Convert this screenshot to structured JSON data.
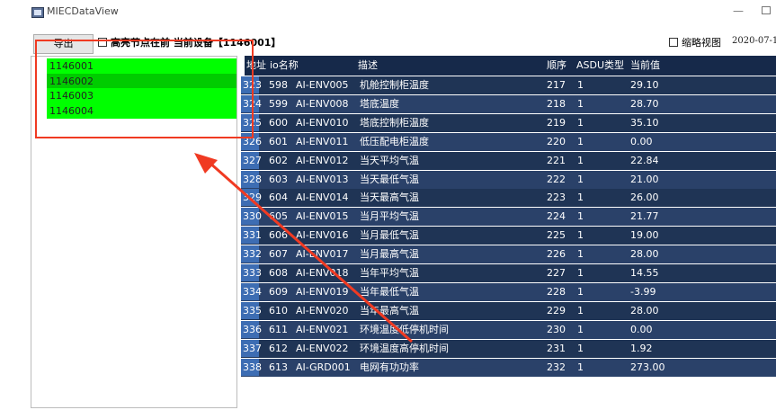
{
  "window": {
    "title": "MIECDataView",
    "minimize_glyph": "—"
  },
  "toolbar": {
    "export_label": "导出",
    "show_label": "高亮节点在前  当前设备【1146001】",
    "thumbnail_label": "缩略视图",
    "date": "2020-07-1"
  },
  "devices": [
    "1146001",
    "1146002",
    "1146003",
    "1146004"
  ],
  "columns": {
    "addr": "地址",
    "io_name": "io名称",
    "desc": "描述",
    "order": "顺序",
    "asdu": "ASDU类型",
    "value": "当前值"
  },
  "rows": [
    {
      "n": "323",
      "addr": "598",
      "io": "AI-ENV005",
      "desc": "机舱控制柜温度",
      "order": "217",
      "asdu": "1",
      "value": "29.10"
    },
    {
      "n": "324",
      "addr": "599",
      "io": "AI-ENV008",
      "desc": "塔底温度",
      "order": "218",
      "asdu": "1",
      "value": "28.70"
    },
    {
      "n": "325",
      "addr": "600",
      "io": "AI-ENV010",
      "desc": "塔底控制柜温度",
      "order": "219",
      "asdu": "1",
      "value": "35.10"
    },
    {
      "n": "326",
      "addr": "601",
      "io": "AI-ENV011",
      "desc": "低压配电柜温度",
      "order": "220",
      "asdu": "1",
      "value": "0.00"
    },
    {
      "n": "327",
      "addr": "602",
      "io": "AI-ENV012",
      "desc": "当天平均气温",
      "order": "221",
      "asdu": "1",
      "value": "22.84"
    },
    {
      "n": "328",
      "addr": "603",
      "io": "AI-ENV013",
      "desc": "当天最低气温",
      "order": "222",
      "asdu": "1",
      "value": "21.00"
    },
    {
      "n": "329",
      "addr": "604",
      "io": "AI-ENV014",
      "desc": "当天最高气温",
      "order": "223",
      "asdu": "1",
      "value": "26.00"
    },
    {
      "n": "330",
      "addr": "605",
      "io": "AI-ENV015",
      "desc": "当月平均气温",
      "order": "224",
      "asdu": "1",
      "value": "21.77"
    },
    {
      "n": "331",
      "addr": "606",
      "io": "AI-ENV016",
      "desc": "当月最低气温",
      "order": "225",
      "asdu": "1",
      "value": "19.00"
    },
    {
      "n": "332",
      "addr": "607",
      "io": "AI-ENV017",
      "desc": "当月最高气温",
      "order": "226",
      "asdu": "1",
      "value": "28.00"
    },
    {
      "n": "333",
      "addr": "608",
      "io": "AI-ENV018",
      "desc": "当年平均气温",
      "order": "227",
      "asdu": "1",
      "value": "14.55"
    },
    {
      "n": "334",
      "addr": "609",
      "io": "AI-ENV019",
      "desc": "当年最低气温",
      "order": "228",
      "asdu": "1",
      "value": "-3.99"
    },
    {
      "n": "335",
      "addr": "610",
      "io": "AI-ENV020",
      "desc": "当年最高气温",
      "order": "229",
      "asdu": "1",
      "value": "28.00"
    },
    {
      "n": "336",
      "addr": "611",
      "io": "AI-ENV021",
      "desc": "环境温度低停机时间",
      "order": "230",
      "asdu": "1",
      "value": "0.00"
    },
    {
      "n": "337",
      "addr": "612",
      "io": "AI-ENV022",
      "desc": "环境温度高停机时间",
      "order": "231",
      "asdu": "1",
      "value": "1.92"
    },
    {
      "n": "338",
      "addr": "613",
      "io": "AI-GRD001",
      "desc": "电网有功功率",
      "order": "232",
      "asdu": "1",
      "value": "273.00"
    }
  ],
  "colors": {
    "header_bg": "#16294a",
    "row_dark": "#1f3455",
    "row_light": "#2a4169",
    "rownum_bg": "#3d6db3",
    "device_highlight": "#00ff00",
    "device_selected": "#00cc00",
    "annotation_red": "#f03a22"
  }
}
